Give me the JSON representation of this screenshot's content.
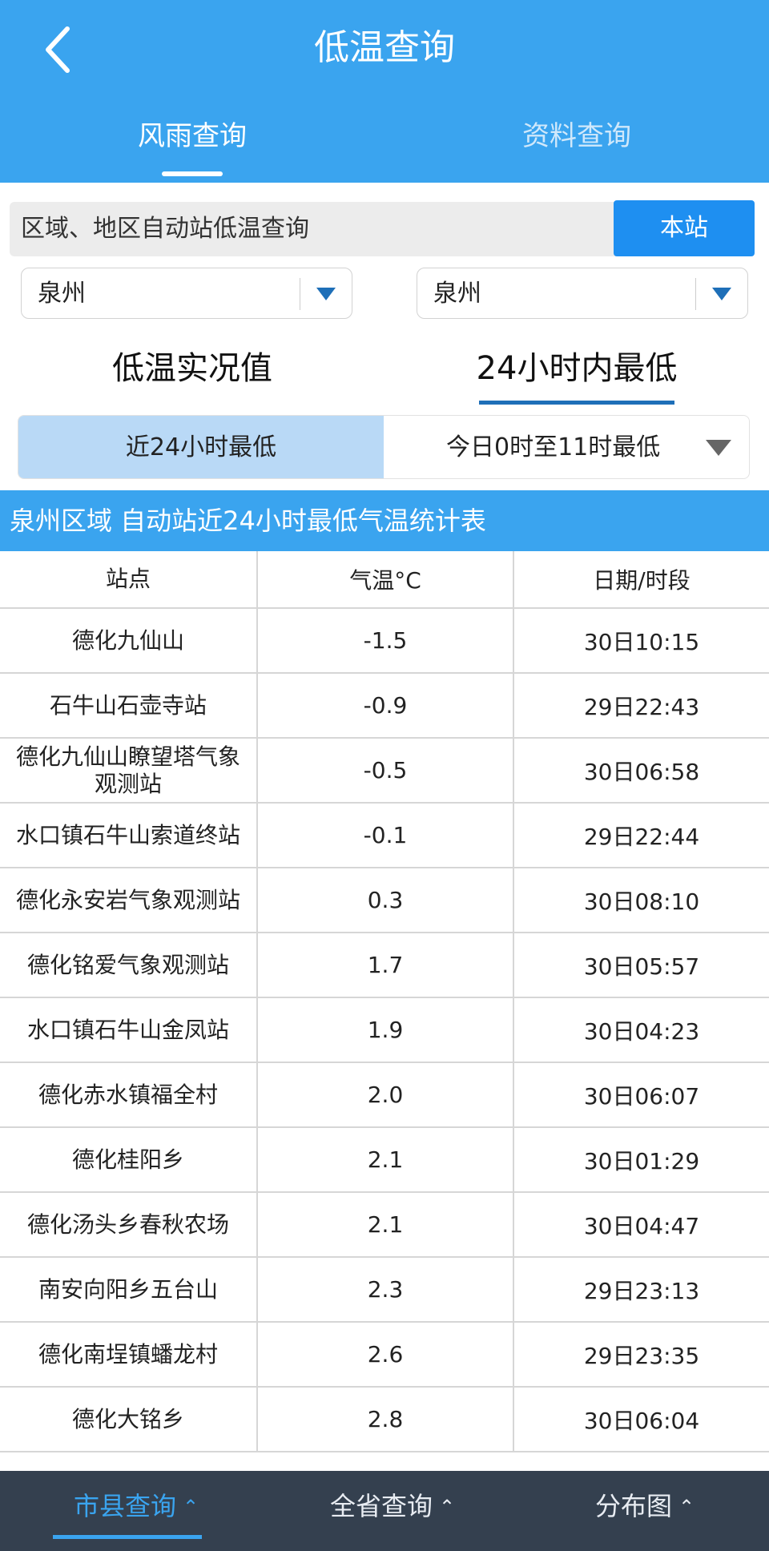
{
  "header": {
    "title": "低温查询",
    "tabs": [
      "风雨查询",
      "资料查询"
    ]
  },
  "query": {
    "text": "区域、地区自动站低温查询",
    "button": "本站"
  },
  "selects": [
    "泉州",
    "泉州"
  ],
  "modes": [
    "低温实况值",
    "24小时内最低"
  ],
  "periods": [
    "近24小时最低",
    "今日0时至11时最低"
  ],
  "banner": "泉州区域 自动站近24小时最低气温统计表",
  "table": {
    "headers": [
      "站点",
      "气温°C",
      "日期/时段"
    ],
    "rows": [
      {
        "station": "德化九仙山",
        "temp": "-1.5",
        "time": "30日10:15"
      },
      {
        "station": "石牛山石壶寺站",
        "temp": "-0.9",
        "time": "29日22:43"
      },
      {
        "station": "德化九仙山瞭望塔气象观测站",
        "temp": "-0.5",
        "time": "30日06:58"
      },
      {
        "station": "水口镇石牛山索道终站",
        "temp": "-0.1",
        "time": "29日22:44"
      },
      {
        "station": "德化永安岩气象观测站",
        "temp": "0.3",
        "time": "30日08:10"
      },
      {
        "station": "德化铭爱气象观测站",
        "temp": "1.7",
        "time": "30日05:57"
      },
      {
        "station": "水口镇石牛山金凤站",
        "temp": "1.9",
        "time": "30日04:23"
      },
      {
        "station": "德化赤水镇福全村",
        "temp": "2.0",
        "time": "30日06:07"
      },
      {
        "station": "德化桂阳乡",
        "temp": "2.1",
        "time": "30日01:29"
      },
      {
        "station": "德化汤头乡春秋农场",
        "temp": "2.1",
        "time": "30日04:47"
      },
      {
        "station": "南安向阳乡五台山",
        "temp": "2.3",
        "time": "29日23:13"
      },
      {
        "station": "德化南埕镇蟠龙村",
        "temp": "2.6",
        "time": "29日23:35"
      },
      {
        "station": "德化大铭乡",
        "temp": "2.8",
        "time": "30日06:04"
      }
    ]
  },
  "bottom_nav": [
    "市县查询",
    "全省查询",
    "分布图"
  ],
  "colors": {
    "primary": "#3aa4ef",
    "button": "#1e8ff1",
    "selected_period": "#b9d9f6",
    "bottom_bar": "#34404f"
  },
  "icons": {
    "back": "chevron-left-icon",
    "dropdown": "triangle-down-icon",
    "caret": "chevron-up-icon"
  }
}
